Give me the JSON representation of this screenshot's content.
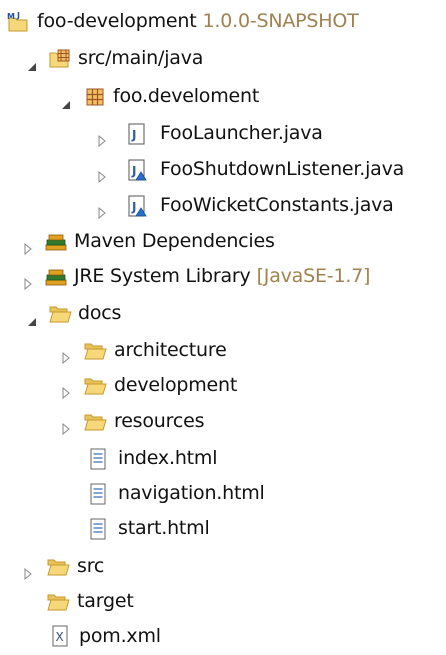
{
  "tree": {
    "project": {
      "label": "foo-development",
      "decoration": "1.0.0-SNAPSHOT",
      "icon": "maven-project-icon"
    },
    "src_main_java": {
      "label": "src/main/java",
      "icon": "source-folder-icon"
    },
    "package": {
      "label": "foo.develoment",
      "icon": "package-icon"
    },
    "file_launcher": {
      "label": "FooLauncher.java",
      "icon": "java-file-icon"
    },
    "file_shutdown": {
      "label": "FooShutdownListener.java",
      "icon": "java-file-icon"
    },
    "file_constants": {
      "label": "FooWicketConstants.java",
      "icon": "java-file-icon"
    },
    "maven_deps": {
      "label": "Maven Dependencies",
      "icon": "library-icon"
    },
    "jre": {
      "label": "JRE System Library",
      "decoration": "[JavaSE-1.7]",
      "icon": "library-icon"
    },
    "docs": {
      "label": "docs",
      "icon": "folder-icon"
    },
    "architecture": {
      "label": "architecture",
      "icon": "folder-icon"
    },
    "development": {
      "label": "development",
      "icon": "folder-icon"
    },
    "resources": {
      "label": "resources",
      "icon": "folder-icon"
    },
    "index_html": {
      "label": "index.html",
      "icon": "html-file-icon"
    },
    "navigation_html": {
      "label": "navigation.html",
      "icon": "html-file-icon"
    },
    "start_html": {
      "label": "start.html",
      "icon": "html-file-icon"
    },
    "src": {
      "label": "src",
      "icon": "folder-icon"
    },
    "target": {
      "label": "target",
      "icon": "folder-icon"
    },
    "pom": {
      "label": "pom.xml",
      "icon": "xml-file-icon"
    }
  },
  "colors": {
    "decoration_text": "#a08250",
    "folder_fill": "#f6d77a",
    "folder_stroke": "#c79a2a",
    "text": "#111111"
  }
}
